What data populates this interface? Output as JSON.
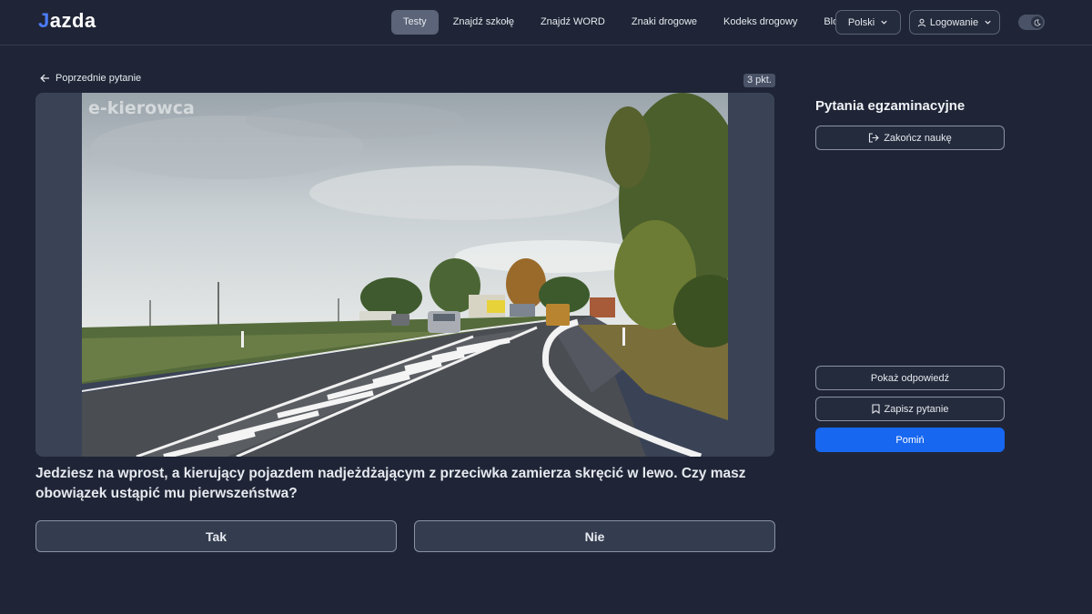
{
  "header": {
    "logo_j": "J",
    "logo_rest": "azda",
    "nav": [
      {
        "label": "Testy",
        "active": true
      },
      {
        "label": "Znajdź szkołę",
        "active": false
      },
      {
        "label": "Znajdź WORD",
        "active": false
      },
      {
        "label": "Znaki drogowe",
        "active": false
      },
      {
        "label": "Kodeks drogowy",
        "active": false
      },
      {
        "label": "Blog",
        "active": false
      }
    ],
    "language": "Polski",
    "login": "Logowanie",
    "theme_toggle_icon": "moon-icon"
  },
  "question_panel": {
    "prev_label": "Poprzednie pytanie",
    "points": "3 pkt.",
    "watermark": "e-kierowca",
    "question_text": "Jedziesz na wprost, a kierujący pojazdem nadjeżdżającym z przeciwka zamierza skręcić w lewo. Czy masz obowiązek ustąpić mu pierwszeństwa?",
    "answers": [
      "Tak",
      "Nie"
    ]
  },
  "sidebar": {
    "title": "Pytania egzaminacyjne",
    "end_label": "Zakończ naukę",
    "show_answer_label": "Pokaż odpowiedź",
    "save_label": "Zapisz pytanie",
    "skip_label": "Pomiń"
  },
  "colors": {
    "background": "#1f2536",
    "accent": "#1767f0",
    "active_nav": "#5b6478"
  }
}
